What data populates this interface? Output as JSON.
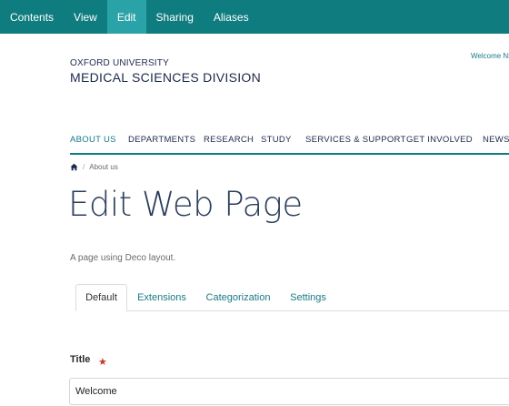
{
  "toolbar": {
    "items": [
      {
        "label": "Contents",
        "active": false
      },
      {
        "label": "View",
        "active": false
      },
      {
        "label": "Edit",
        "active": true
      },
      {
        "label": "Sharing",
        "active": false
      },
      {
        "label": "Aliases",
        "active": false
      }
    ]
  },
  "brand": {
    "line1": "OXFORD UNIVERSITY",
    "line2": "MEDICAL SCIENCES DIVISION"
  },
  "header": {
    "welcome": "Welcome Ni"
  },
  "nav": {
    "items": [
      {
        "label": "ABOUT US",
        "active": true
      },
      {
        "label": "DEPARTMENTS",
        "active": false
      },
      {
        "label": "RESEARCH",
        "active": false
      },
      {
        "label": "STUDY",
        "active": false
      },
      {
        "label": "SERVICES & SUPPORT",
        "active": false
      },
      {
        "label": "GET INVOLVED",
        "active": false
      },
      {
        "label": "NEWS",
        "active": false
      }
    ]
  },
  "breadcrumb": {
    "home_icon": "home-icon",
    "separator": "/",
    "current": "About us"
  },
  "page": {
    "title": "Edit Web Page",
    "description": "A page using Deco layout."
  },
  "tabs": [
    {
      "label": "Default",
      "active": true
    },
    {
      "label": "Extensions",
      "active": false
    },
    {
      "label": "Categorization",
      "active": false
    },
    {
      "label": "Settings",
      "active": false
    }
  ],
  "form": {
    "title_label": "Title",
    "required_marker": "★",
    "title_value": "Welcome"
  },
  "colors": {
    "toolbar": "#0f7c80",
    "toolbar_active": "#2aa3a8",
    "accent": "#1a7a85",
    "heading": "#2a3d5c"
  }
}
